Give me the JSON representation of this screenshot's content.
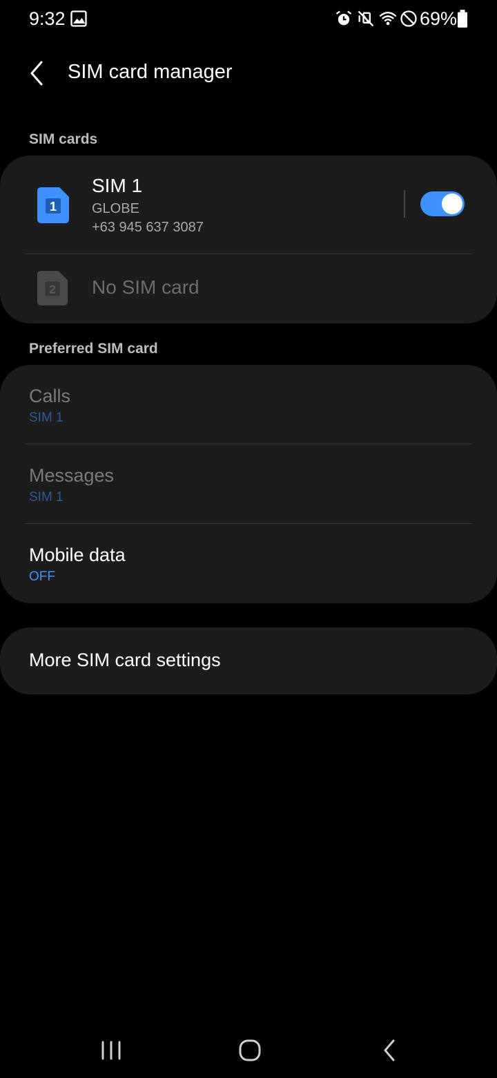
{
  "status_bar": {
    "time": "9:32",
    "battery_percent": "69%",
    "icons": [
      "image-icon",
      "alarm-icon",
      "vibrate-off-icon",
      "wifi-icon",
      "do-not-disturb-icon",
      "battery-icon"
    ]
  },
  "header": {
    "title": "SIM card manager",
    "back_icon": "back-arrow-icon"
  },
  "sim_cards": {
    "section_label": "SIM cards",
    "sim1": {
      "slot_number": "1",
      "name": "SIM 1",
      "carrier": "GLOBE",
      "phone_number": "+63 945 637 3087",
      "enabled": true
    },
    "sim2": {
      "slot_number": "2",
      "label": "No SIM card"
    }
  },
  "preferred": {
    "section_label": "Preferred SIM card",
    "calls": {
      "title": "Calls",
      "value": "SIM 1"
    },
    "messages": {
      "title": "Messages",
      "value": "SIM 1"
    },
    "mobile_data": {
      "title": "Mobile data",
      "value": "OFF"
    }
  },
  "more_settings": {
    "label": "More SIM card settings"
  },
  "colors": {
    "accent": "#3e91ff",
    "background": "#000000",
    "card": "#1c1c1c"
  },
  "nav_bar": {
    "icons": [
      "recent-apps-icon",
      "home-icon",
      "back-icon"
    ]
  }
}
